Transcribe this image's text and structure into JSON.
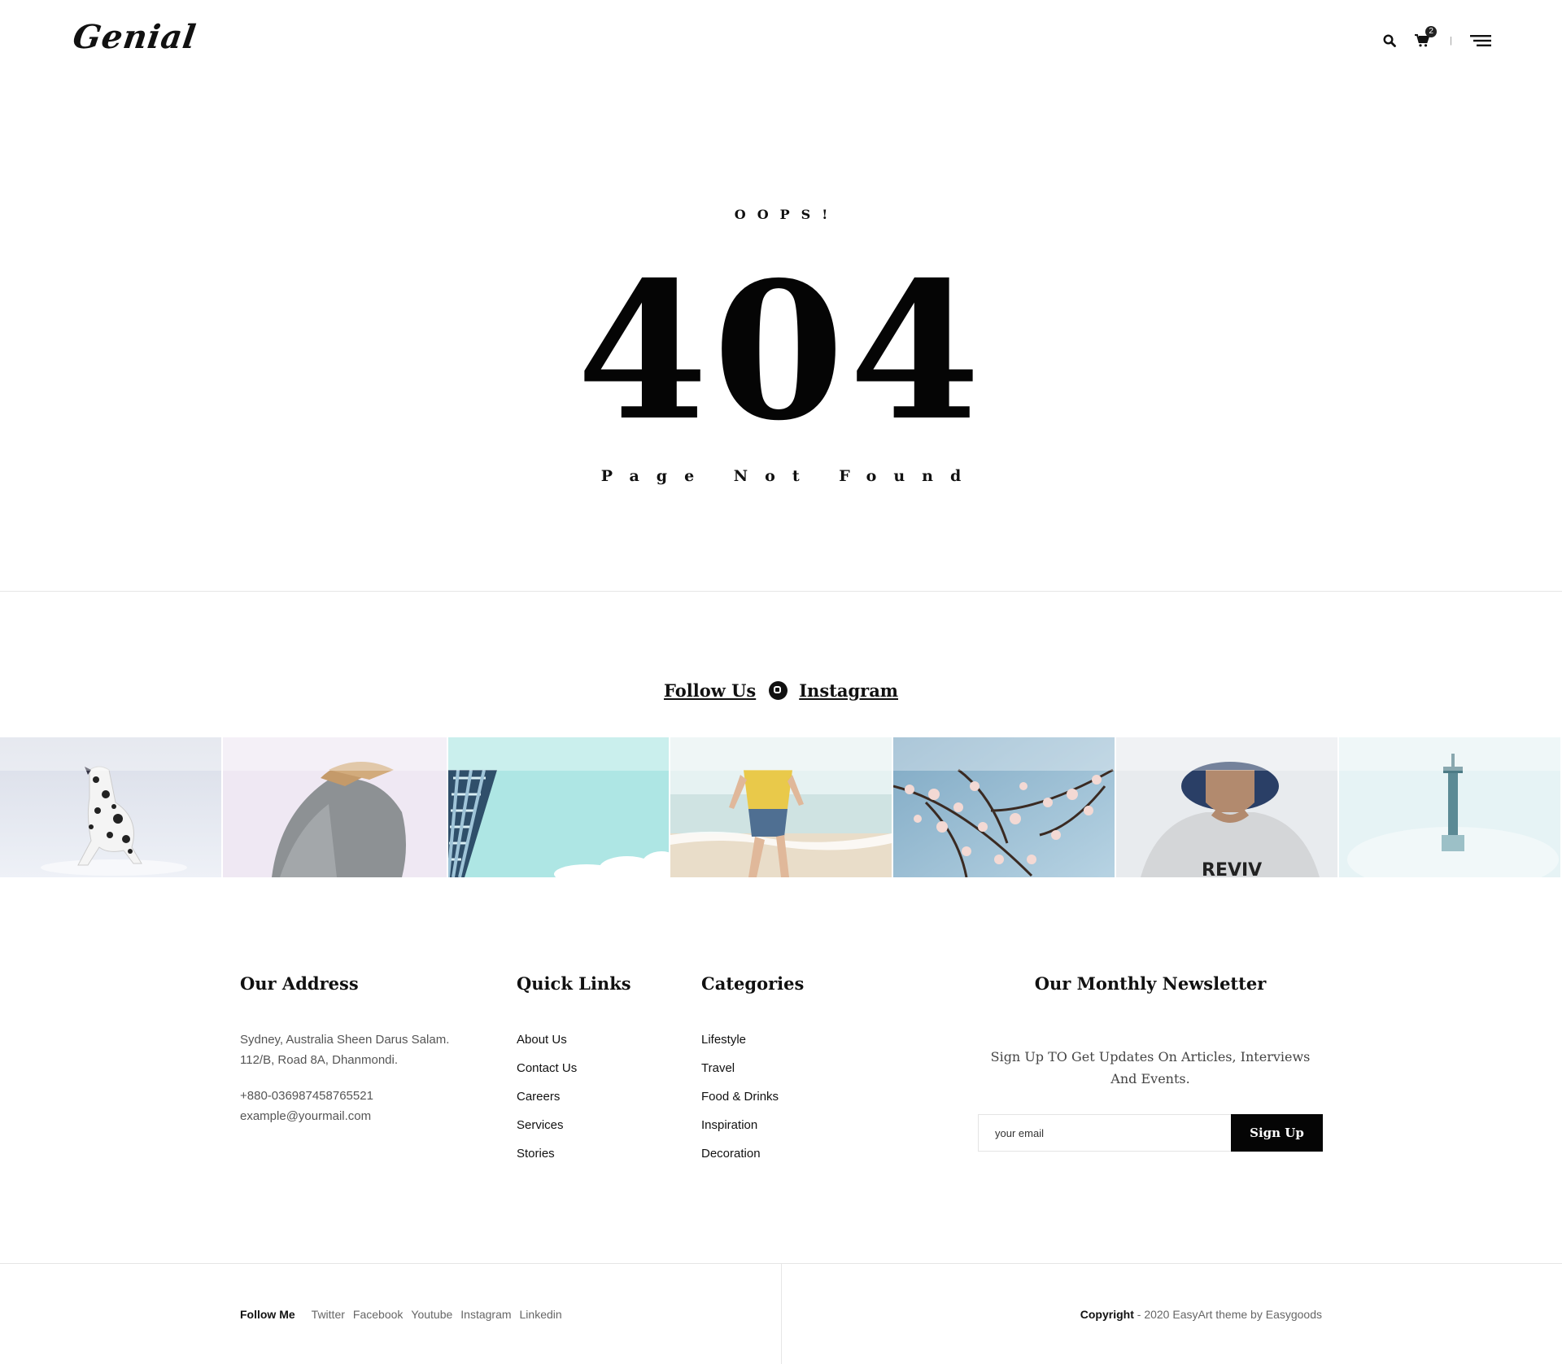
{
  "header": {
    "logo": "Genial",
    "cart_count": "2",
    "divider": "|"
  },
  "error": {
    "oops": "OOPS!",
    "code": "404",
    "message": "Page Not Found"
  },
  "follow": {
    "label": "Follow Us",
    "platform": "Instagram"
  },
  "gallery": [
    {
      "subject": "dalmatian"
    },
    {
      "subject": "grey-sweater"
    },
    {
      "subject": "building"
    },
    {
      "subject": "beach"
    },
    {
      "subject": "blossom"
    },
    {
      "subject": "man-in-hat"
    },
    {
      "subject": "tower"
    }
  ],
  "footer": {
    "address": {
      "title": "Our Address",
      "line1": "Sydney, Australia Sheen Darus Salam.",
      "line2": "112/B, Road 8A, Dhanmondi.",
      "phone": "+880-036987458765521",
      "email": "example@yourmail.com"
    },
    "quick_links": {
      "title": "Quick Links",
      "items": [
        "About Us",
        "Contact Us",
        "Careers",
        "Services",
        "Stories"
      ]
    },
    "categories": {
      "title": "Categories",
      "items": [
        "Lifestyle",
        "Travel",
        "Food & Drinks",
        "Inspiration",
        "Decoration"
      ]
    },
    "newsletter": {
      "title": "Our Monthly Newsletter",
      "description": "Sign Up TO Get Updates On Articles, Interviews And Events.",
      "placeholder": "your email",
      "button": "Sign Up"
    }
  },
  "bottom": {
    "follow_label": "Follow Me",
    "socials": [
      "Twitter",
      "Facebook",
      "Youtube",
      "Instagram",
      "Linkedin"
    ],
    "copyright_label": "Copyright",
    "copyright_text": " - 2020 EasyArt theme by Easygoods"
  }
}
